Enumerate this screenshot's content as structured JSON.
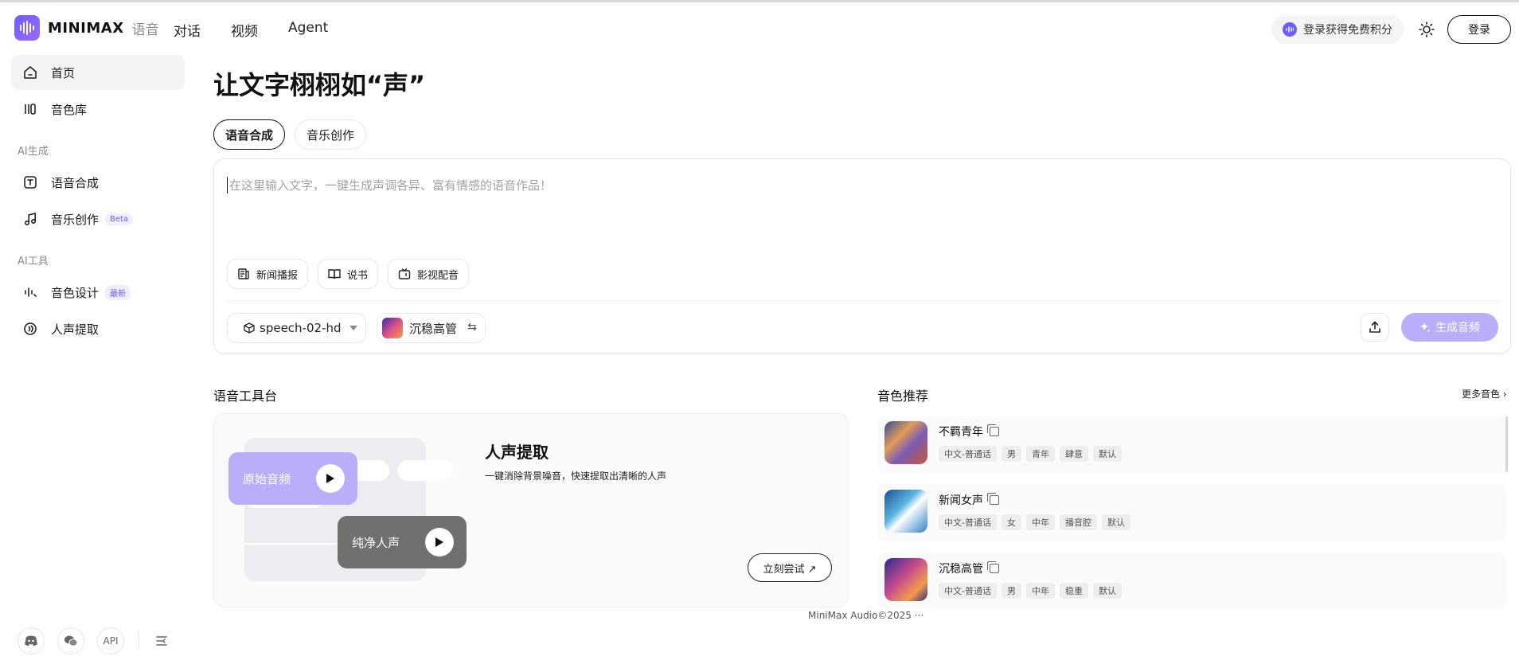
{
  "header": {
    "brand": "MINIMAX",
    "brand_sub": "语音",
    "nav": [
      "对话",
      "视频",
      "Agent"
    ],
    "promo_label": "登录获得免费积分",
    "login_label": "登录"
  },
  "sidebar": {
    "items_top": [
      {
        "label": "首页",
        "icon": "home-icon"
      },
      {
        "label": "音色库",
        "icon": "library-icon"
      }
    ],
    "section_ai_gen": "AI生成",
    "items_gen": [
      {
        "label": "语音合成",
        "icon": "text-to-speech-icon"
      },
      {
        "label": "音乐创作",
        "icon": "music-icon",
        "badge": "Beta"
      }
    ],
    "section_ai_tools": "AI工具",
    "items_tools": [
      {
        "label": "音色设计",
        "icon": "voice-design-icon",
        "badge": "最新"
      },
      {
        "label": "人声提取",
        "icon": "vocal-extract-icon"
      }
    ],
    "bottom": {
      "api_label": "API",
      "icons": [
        "discord-icon",
        "wechat-icon",
        "collapse-sidebar-icon"
      ]
    }
  },
  "main": {
    "title": "让文字栩栩如“声”",
    "tabs": [
      "语音合成",
      "音乐创作"
    ],
    "editor": {
      "placeholder": "在这里输入文字，一键生成声调各异、富有情感的语音作品！",
      "chips": [
        "新闻播报",
        "说书",
        "影视配音"
      ],
      "model": "speech-02-hd",
      "voice": "沉稳高管",
      "generate_label": "生成音频"
    },
    "toolbox": {
      "title": "语音工具台",
      "tool_name": "人声提取",
      "tool_desc": "一键消除背景噪音，快速提取出清晰的人声",
      "original_label": "原始音频",
      "clean_label": "纯净人声",
      "try_label": "立刻尝试 ↗"
    },
    "voices": {
      "title": "音色推荐",
      "more_label": "更多音色 ›",
      "items": [
        {
          "name": "不羁青年",
          "tags": [
            "中文-普通话",
            "男",
            "青年",
            "肆意",
            "默认"
          ]
        },
        {
          "name": "新闻女声",
          "tags": [
            "中文-普通话",
            "女",
            "中年",
            "播音腔",
            "默认"
          ]
        },
        {
          "name": "沉稳高管",
          "tags": [
            "中文-普通话",
            "男",
            "中年",
            "稳重",
            "默认"
          ]
        }
      ]
    },
    "footer": "MiniMax Audio©2025 ···"
  },
  "colors": {
    "accent": "#6d5cff",
    "generate_button": "#b9aef9",
    "clean_card": "#707070"
  }
}
